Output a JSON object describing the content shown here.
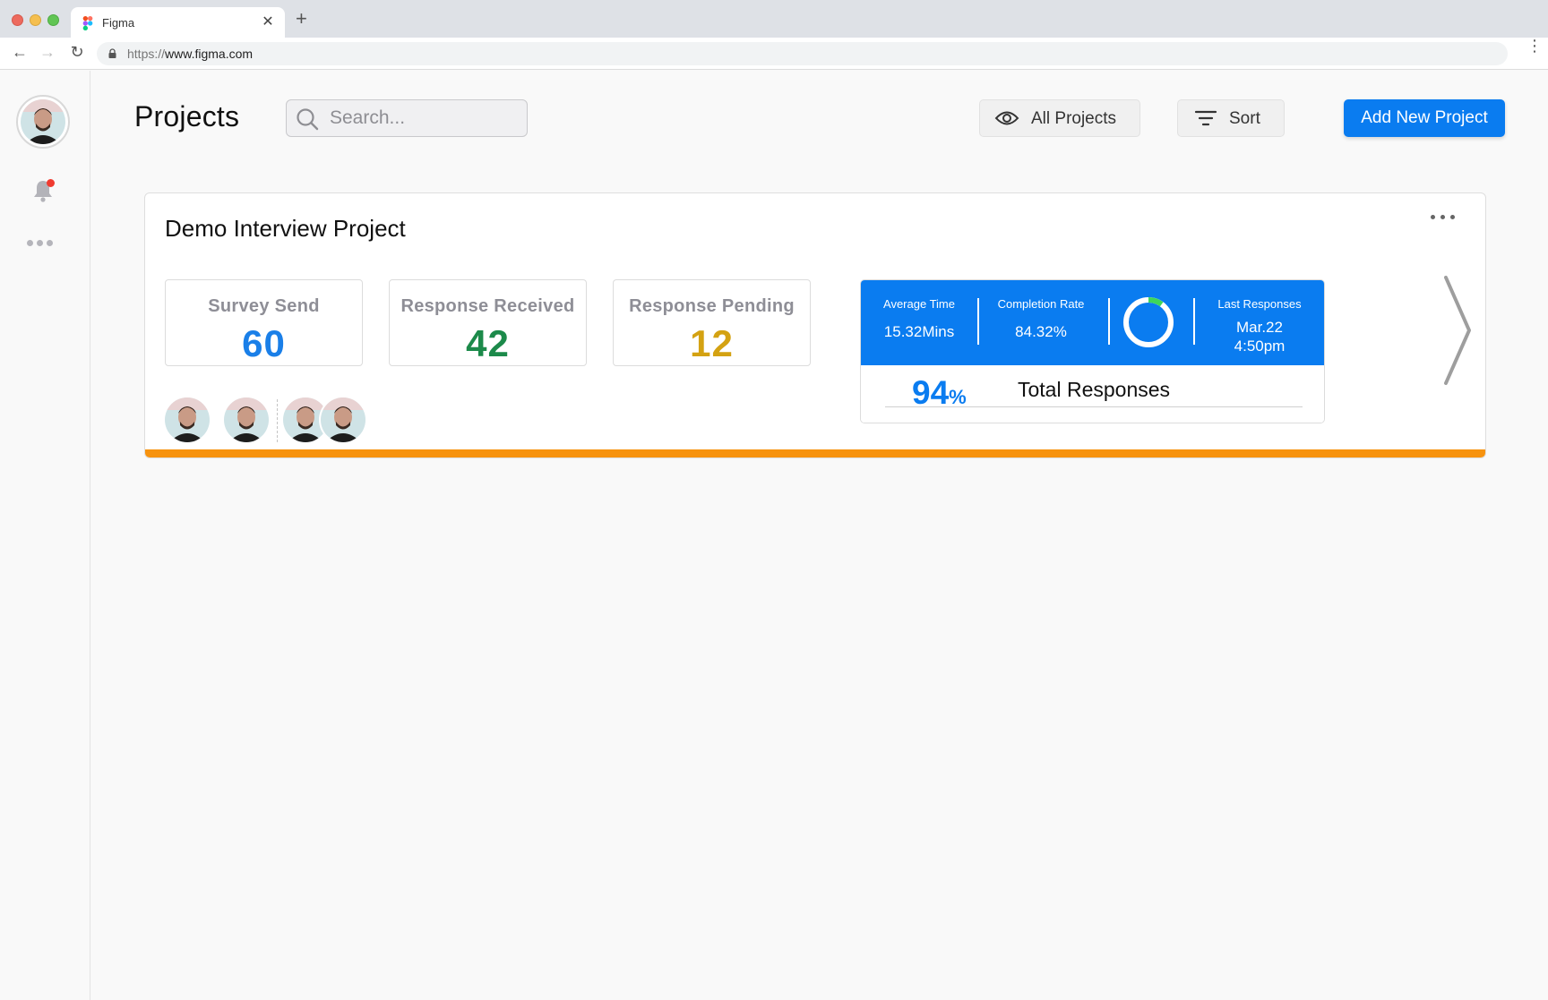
{
  "browser": {
    "tab_title": "Figma",
    "url_protocol": "https://",
    "url_host": "www.figma.com",
    "favicon": "figma-logo-icon"
  },
  "header": {
    "title": "Projects",
    "search_placeholder": "Search...",
    "filter_label": "All Projects",
    "sort_label": "Sort",
    "add_label": "Add New Project"
  },
  "project": {
    "title": "Demo Interview Project",
    "stats": [
      {
        "label": "Survey Send",
        "value": "60",
        "color": "#1a7fe8"
      },
      {
        "label": "Response Received",
        "value": "42",
        "color": "#1c8a4a"
      },
      {
        "label": "Response Pending",
        "value": "12",
        "color": "#d4a212"
      }
    ],
    "metrics": {
      "average_time_label": "Average Time",
      "average_time_value": "15.32Mins",
      "completion_rate_label": "Completion Rate",
      "completion_rate_value": "84.32%",
      "completion_fraction": 0.1,
      "last_responses_label": "Last Responses",
      "last_responses_date": "Mar.22",
      "last_responses_time": "4:50pm",
      "total_pct_value": "94",
      "total_pct_unit": "%",
      "total_label": "Total Responses"
    },
    "accent_bar_color": "#f7930f"
  },
  "colors": {
    "primary": "#0a7cf0",
    "notification_dot": "#f03b30",
    "donut_progress": "#3ed65a"
  }
}
